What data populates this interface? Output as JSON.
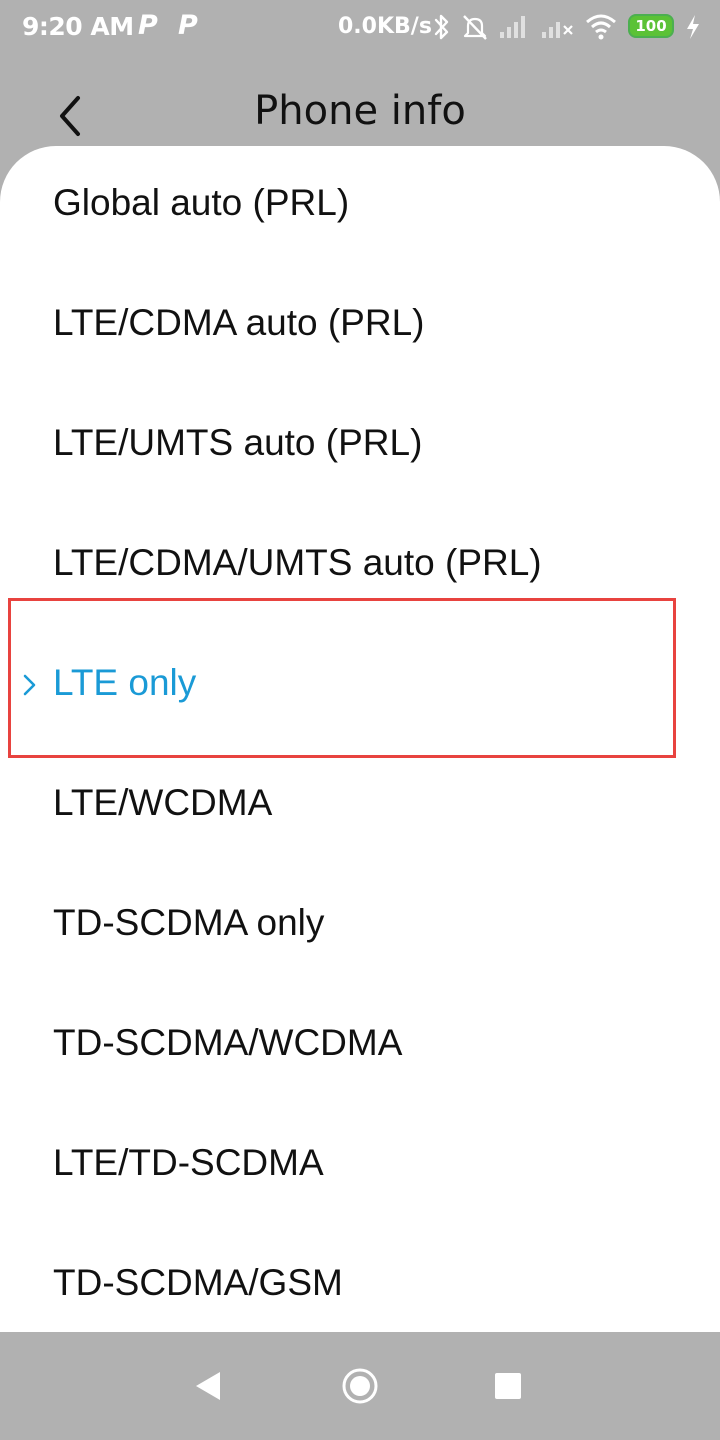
{
  "status_bar": {
    "time": "9:20 AM",
    "notif_icons": [
      "P",
      "P"
    ],
    "net_speed": "0.0KB/s",
    "battery_level": "100",
    "icons": [
      "bluetooth-icon",
      "alarm-off-icon",
      "signal-icon",
      "signal-icon",
      "wifi-icon",
      "battery-icon",
      "charging-icon"
    ]
  },
  "header": {
    "title": "Phone info"
  },
  "network_modes": {
    "selected_index": 4,
    "items": [
      {
        "label": "Global auto (PRL)"
      },
      {
        "label": "LTE/CDMA auto (PRL)"
      },
      {
        "label": "LTE/UMTS auto (PRL)"
      },
      {
        "label": "LTE/CDMA/UMTS auto (PRL)"
      },
      {
        "label": "LTE only"
      },
      {
        "label": "LTE/WCDMA"
      },
      {
        "label": "TD-SCDMA only"
      },
      {
        "label": "TD-SCDMA/WCDMA"
      },
      {
        "label": "LTE/TD-SCDMA"
      },
      {
        "label": "TD-SCDMA/GSM"
      }
    ]
  },
  "colors": {
    "selected_text": "#1a9ad6",
    "highlight_border": "#e8433f",
    "scrim": "#b1b1b1",
    "battery_fill": "#5bc236"
  },
  "nav_bar": {
    "icons": [
      "back-triangle-icon",
      "home-circle-icon",
      "recents-square-icon"
    ]
  }
}
